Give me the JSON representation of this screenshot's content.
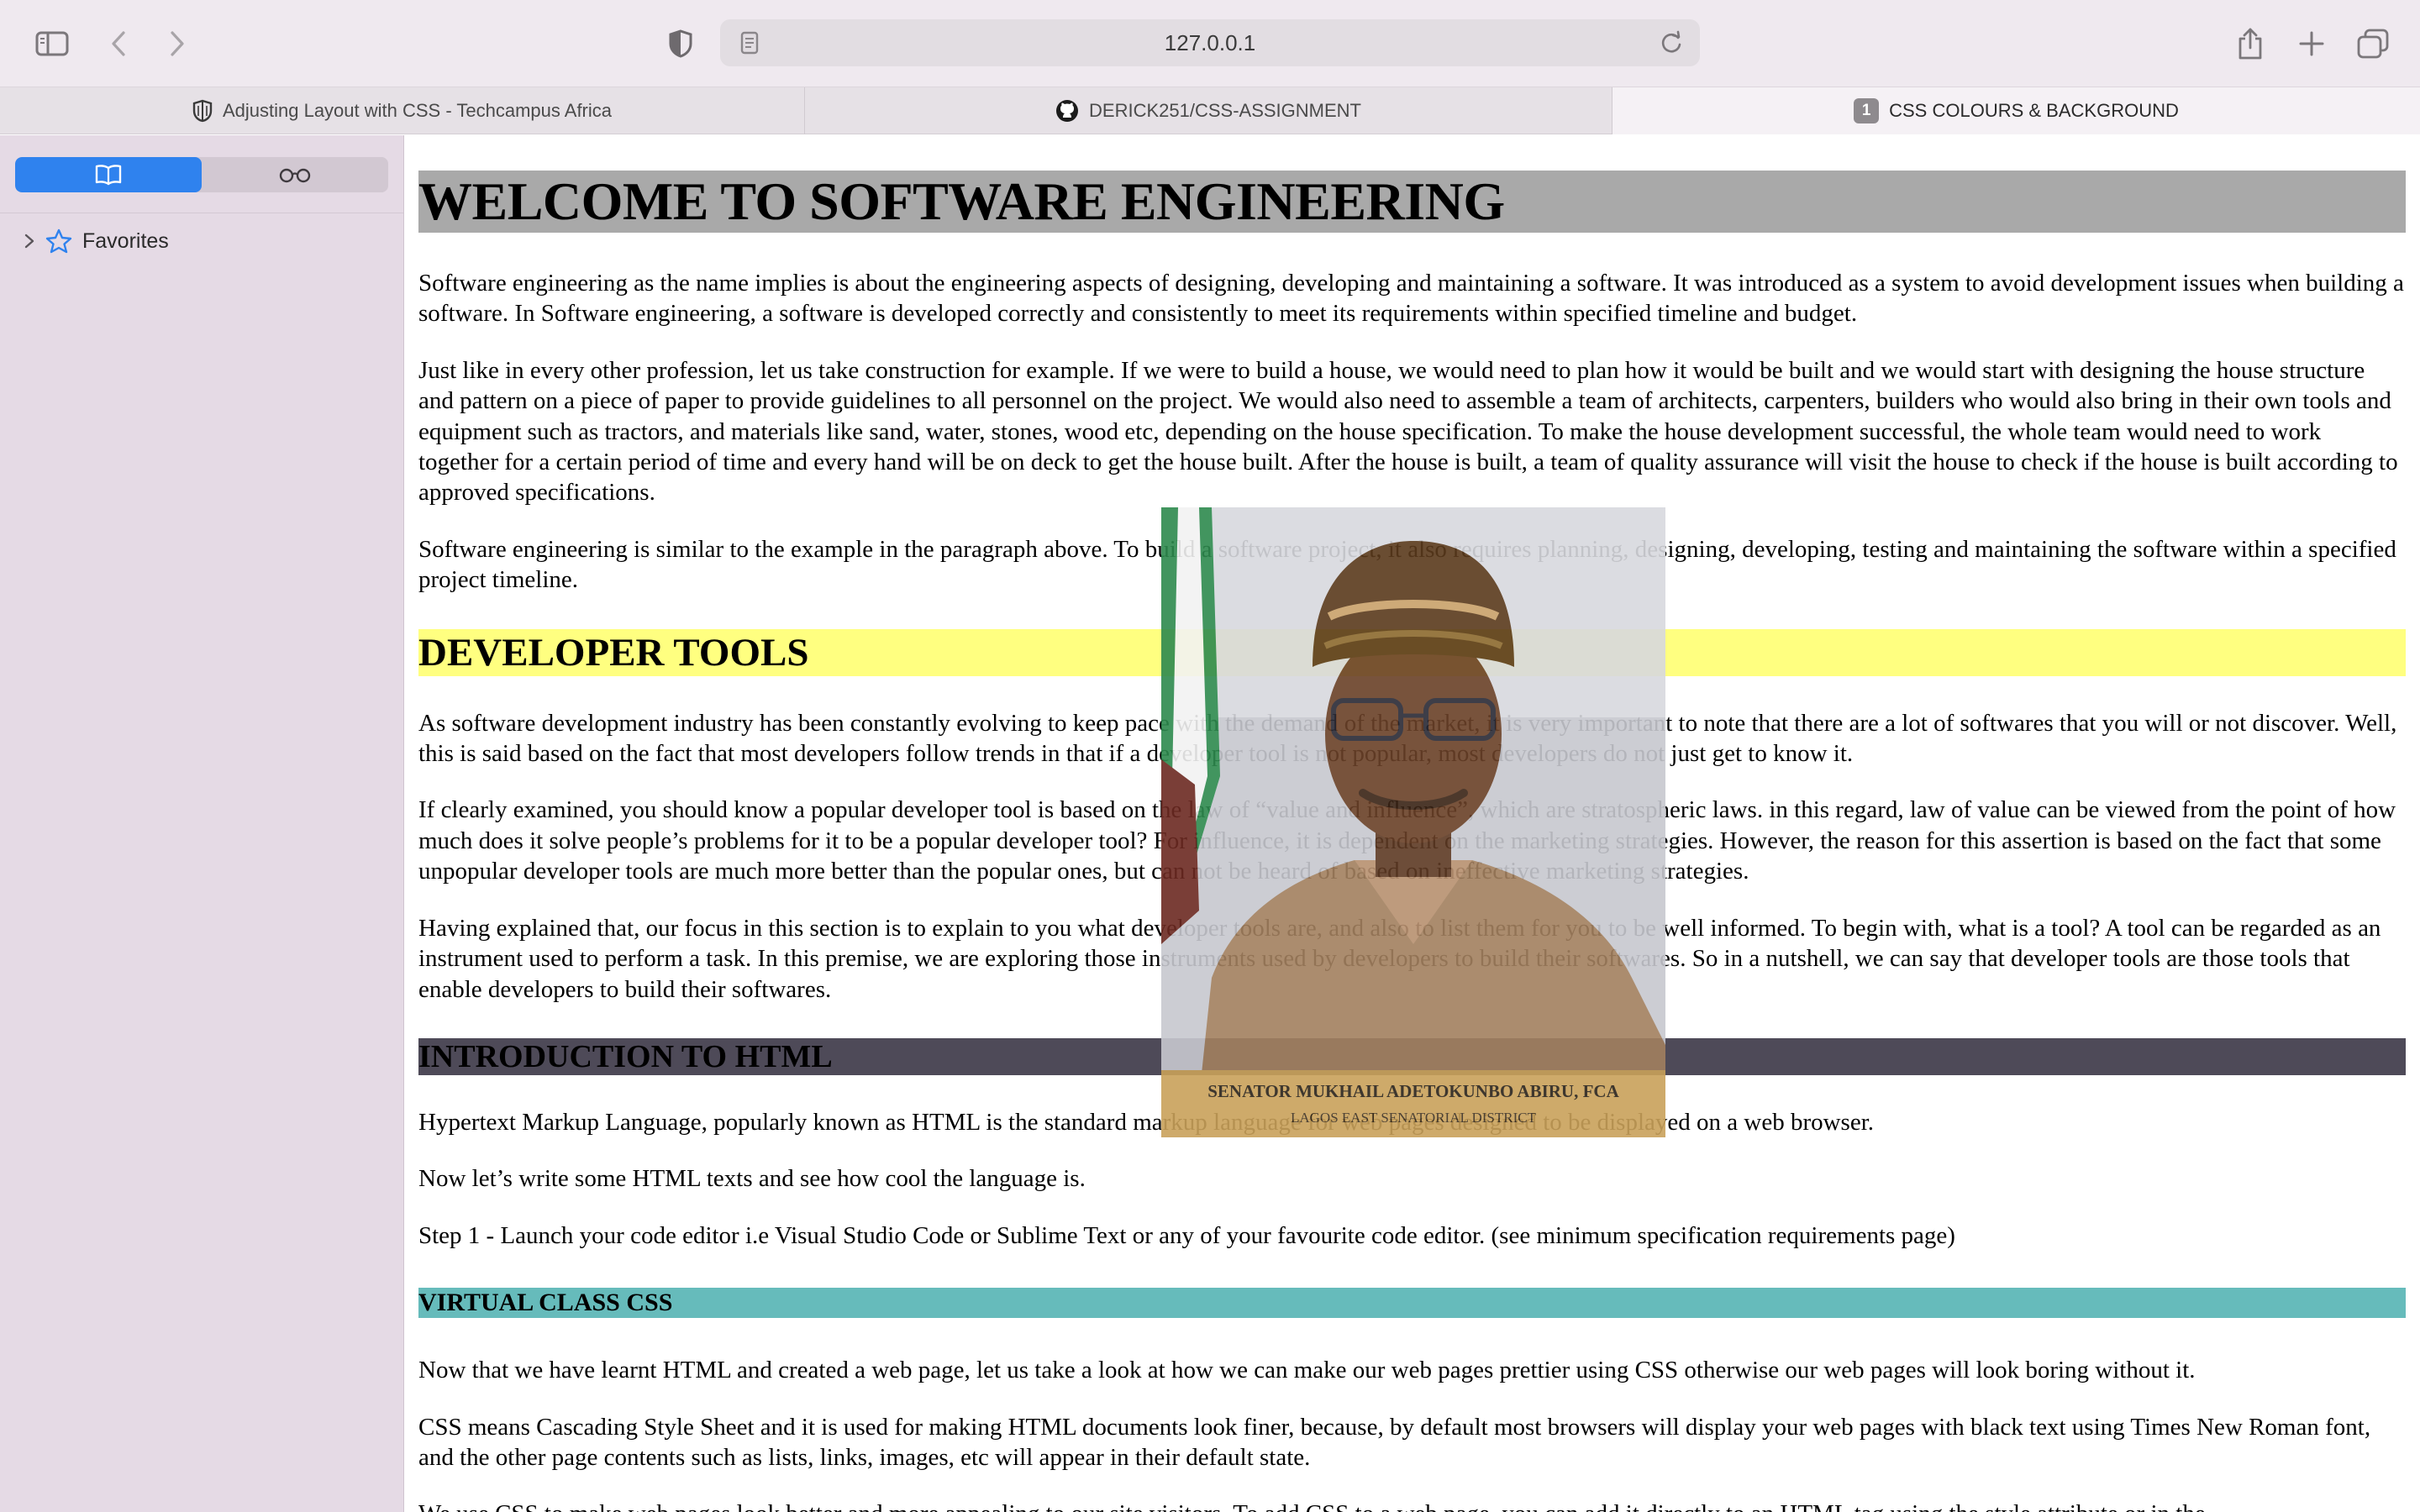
{
  "browser": {
    "url": "127.0.0.1",
    "tabs": [
      {
        "title": "Adjusting Layout with CSS - Techcampus Africa",
        "icon": "shield-icon"
      },
      {
        "title": "DERICK251/CSS-ASSIGNMENT",
        "icon": "github-icon"
      },
      {
        "title": "CSS COLOURS & BACKGROUND",
        "badge": "1",
        "active": true
      }
    ],
    "accent": "#2f82ee"
  },
  "sidebar": {
    "favorites_label": "Favorites",
    "segments": [
      "bookmarks-icon",
      "reading-list-icon"
    ]
  },
  "page": {
    "h1": "WELCOME TO SOFTWARE ENGINEERING",
    "p1": "Software engineering as the name implies is about the engineering aspects of designing, developing and maintaining a software. It was introduced as a system to avoid development issues when building a software. In Software engineering, a software is developed correctly and consistently to meet its requirements within specified timeline and budget.",
    "p2": "Just like in every other profession, let us take construction for example. If we were to build a house, we would need to plan how it would be built and we would start with designing the house structure and pattern on a piece of paper to provide guidelines to all personnel on the project. We would also need to assemble a team of architects, carpenters, builders who would also bring in their own tools and equipment such as tractors, and materials like sand, water, stones, wood etc, depending on the house specification. To make the house development successful, the whole team would need to work together for a certain period of time and every hand will be on deck to get the house built. After the house is built, a team of quality assurance will visit the house to check if the house is built according to approved specifications.",
    "p3": "Software engineering is similar to the example in the paragraph above. To build a software project, it also requires planning, designing, developing, testing and maintaining the software within a specified project timeline.",
    "h2": "DEVELOPER TOOLS",
    "p4": "As software development industry has been constantly evolving to keep pace with the demand of the market, it is very important to note that there are a lot of softwares that you will or not discover. Well, this is said based on the fact that most developers follow trends in that if a developer tool is not popular, most developers do not just get to know it.",
    "p5": "If clearly examined, you should know a popular developer tool is based on the law of “value and influence”, which are stratospheric laws. in this regard, law of value can be viewed from the point of how much does it solve people’s problems for it to be a popular developer tool? For influence, it is dependent on the marketing strategies. However, the reason for this assertion is based on the fact that some unpopular developer tools are much more better than the popular ones, but can not be heard of based on ineffective marketing strategies.",
    "p6": "Having explained that, our focus in this section is to explain to you what developer tools are, and also to list them for you to be well informed. To begin with, what is a tool? A tool can be regarded as an instrument used to perform a task. In this premise, we are exploring those instruments used by developers to build their softwares. So in a nutshell, we can say that developer tools are those tools that enable developers to build their softwares.",
    "h3": "INTRODUCTION TO HTML",
    "p7": "Hypertext Markup Language, popularly known as HTML is the standard markup language for web pages designed to be displayed on a web browser.",
    "p8": "Now let’s write some HTML texts and see how cool the language is.",
    "p9": "Step 1 - Launch your code editor  i.e Visual Studio Code or Sublime Text or any of your favourite code editor. (see minimum specification requirements page)",
    "h4": "VIRTUAL CLASS CSS",
    "p10": "Now that we have learnt HTML and created a web page, let us take a look at how we can make our web pages prettier using CSS otherwise our web pages will look boring without it.",
    "p11": "CSS means Cascading Style Sheet and it is used for making HTML documents look finer, because, by default most browsers will display your web pages with black text using Times New Roman font, and the other page contents such as lists, links, images, etc will appear in their default state.",
    "p12": "We use CSS to make web pages look better and more appealing to our site visitors. To add CSS to a web page, you can add it directly to an HTML tag using the style attribute or in the"
  },
  "photo": {
    "caption_name": "SENATOR MUKHAIL ADETOKUNBO ABIRU, FCA",
    "caption_district": "LAGOS EAST SENATORIAL DISTRICT"
  }
}
